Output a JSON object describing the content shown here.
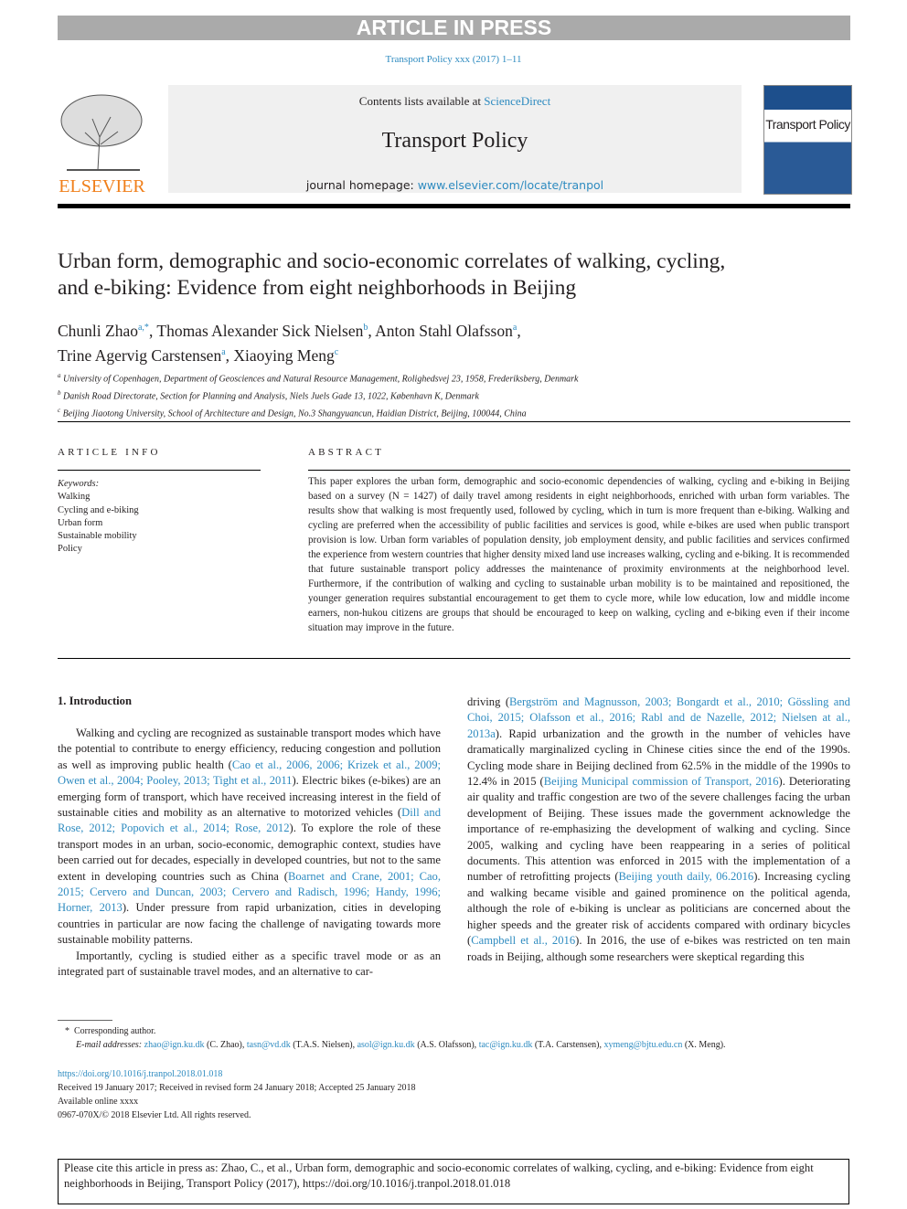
{
  "banner": "ARTICLE IN PRESS",
  "journal_ref": "Transport Policy xxx (2017) 1–11",
  "masthead": {
    "contents_prefix": "Contents lists available at ",
    "contents_link": "ScienceDirect",
    "journal_title": "Transport Policy",
    "homepage_prefix": "journal homepage: ",
    "homepage_link": "www.elsevier.com/locate/tranpol",
    "publisher": "ELSEVIER",
    "cover_title": "Transport Policy"
  },
  "title": "Urban form, demographic and socio-economic correlates of walking, cycling, and e-biking: Evidence from eight neighborhoods in Beijing",
  "authors": [
    {
      "name": "Chunli Zhao",
      "sup": "a,*"
    },
    {
      "name": "Thomas Alexander Sick Nielsen",
      "sup": "b"
    },
    {
      "name": "Anton Stahl Olafsson",
      "sup": "a"
    },
    {
      "name": "Trine Agervig Carstensen",
      "sup": "a"
    },
    {
      "name": "Xiaoying Meng",
      "sup": "c"
    }
  ],
  "affiliations": [
    {
      "sup": "a",
      "text": "University of Copenhagen, Department of Geosciences and Natural Resource Management, Rolighedsvej 23, 1958, Frederiksberg, Denmark"
    },
    {
      "sup": "b",
      "text": "Danish Road Directorate, Section for Planning and Analysis, Niels Juels Gade 13, 1022, København K, Denmark"
    },
    {
      "sup": "c",
      "text": "Beijing Jiaotong University, School of Architecture and Design, No.3 Shangyuancun, Haidian District, Beijing, 100044, China"
    }
  ],
  "article_info": {
    "heading": "ARTICLE INFO",
    "keywords_label": "Keywords:",
    "keywords": [
      "Walking",
      "Cycling and e-biking",
      "Urban form",
      "Sustainable mobility",
      "Policy"
    ]
  },
  "abstract": {
    "heading": "ABSTRACT",
    "text": "This paper explores the urban form, demographic and socio-economic dependencies of walking, cycling and e-biking in Beijing based on a survey (N = 1427) of daily travel among residents in eight neighborhoods, enriched with urban form variables. The results show that walking is most frequently used, followed by cycling, which in turn is more frequent than e-biking. Walking and cycling are preferred when the accessibility of public facilities and services is good, while e-bikes are used when public transport provision is low. Urban form variables of population density, job employment density, and public facilities and services confirmed the experience from western countries that higher density mixed land use increases walking, cycling and e-biking. It is recommended that future sustainable transport policy addresses the maintenance of proximity environments at the neighbor­hood level. Furthermore, if the contribution of walking and cycling to sustainable urban mobility is to be maintained and repositioned, the younger generation requires substantial encouragement to get them to cycle more, while low education, low and middle income earners, non-hukou citizens are groups that should be encouraged to keep on walking, cycling and e-biking even if their income situation may improve in the future."
  },
  "section_heading": "1.  Introduction",
  "col1": [
    [
      {
        "t": "Walking and cycling are recognized as sustainable transport modes which have the potential to contribute to energy efficiency, reducing congestion and pollution as well as improving public health ("
      },
      {
        "t": "Cao et al., 2006, 2006; Krizek et al., 2009; Owen et al., 2004; Pooley, 2013; Tight et al., 2011",
        "l": 1
      },
      {
        "t": "). Electric bikes (e-bikes) are an emerging form of transport, which have received increasing interest in the field of sustainable cities and mobility as an alternative to motorized vehicles ("
      },
      {
        "t": "Dill and Rose, 2012; Popovich et al., 2014; Rose, 2012",
        "l": 1
      },
      {
        "t": "). To explore the role of these transport modes in an urban, socio-economic, demographic context, studies have been carried out for decades, especially in developed countries, but not to the same extent in developing countries such as China ("
      },
      {
        "t": "Boarnet and Crane, 2001; Cao, 2015; Cervero and Duncan, 2003; Cervero and Rad­isch, 1996; Handy, 1996; Horner, 2013",
        "l": 1
      },
      {
        "t": "). Under pressure from rapid ur­banization, cities in developing countries in particular are now facing the challenge of navigating towards more sustainable mobility patterns."
      }
    ],
    [
      {
        "t": "Importantly, cycling is studied either as a specific travel mode or as an integrated part of sustainable travel modes, and an alternative to car-"
      }
    ]
  ],
  "col2": [
    [
      {
        "t": "driving ("
      },
      {
        "t": "Bergström and Magnusson, 2003; Bongardt et al., 2010; Gössling and Choi, 2015; Olafsson et al., 2016; Rabl and de Nazelle, 2012; Nielsen at al., 2013a",
        "l": 1
      },
      {
        "t": "). Rapid urbanization and the growth in the number of vehicles have dramatically marginalized cycling in Chinese cities since the end of the 1990s. Cycling mode share in Beijing declined from 62.5% in the middle of the 1990s to 12.4% in 2015 ("
      },
      {
        "t": "Beijing Municipal commission of Transport, 2016",
        "l": 1
      },
      {
        "t": "). Deteriorating air quality and traffic congestion are two of the severe challenges facing the urban development of Beijing. These issues made the government acknowledge the importance of re-emphasizing the development of walking and cycling. Since 2005, walking and cycling have been reappearing in a series of political documents. This attention was enforced in 2015 with the implementation of a number of retrofitting projects ("
      },
      {
        "t": "Beijing youth daily, 06.2016",
        "l": 1
      },
      {
        "t": "). Increasing cycling and walking became visible and gained prominence on the political agenda, although the role of e-biking is unclear as politicians are concerned about the higher speeds and the greater risk of accidents compared with ordinary bicycles ("
      },
      {
        "t": "Campbell et al., 2016",
        "l": 1
      },
      {
        "t": "). In 2016, the use of e-bikes was restricted on ten main roads in Beijing, although some researchers were skeptical regarding this"
      }
    ]
  ],
  "footnotes": {
    "corresponding": "Corresponding author.",
    "email_label": "E-mail addresses:",
    "emails": [
      {
        "email": "zhao@ign.ku.dk",
        "who": " (C. Zhao), "
      },
      {
        "email": "tasn@vd.dk",
        "who": " (T.A.S. Nielsen), "
      },
      {
        "email": "asol@ign.ku.dk",
        "who": " (A.S. Olafsson), "
      },
      {
        "email": "tac@ign.ku.dk",
        "who": " (T.A. Carstensen), "
      },
      {
        "email": "xymeng@bjtu.edu.cn",
        "who": " (X. Meng)."
      }
    ],
    "doi": "https://doi.org/10.1016/j.tranpol.2018.01.018",
    "received": "Received 19 January 2017; Received in revised form 24 January 2018; Accepted 25 January 2018",
    "available": "Available online xxxx",
    "copyright": "0967-070X/© 2018 Elsevier Ltd. All rights reserved."
  },
  "citation": "Please cite this article in press as: Zhao, C., et al., Urban form, demographic and socio-economic correlates of walking, cycling, and e-biking: Evidence from eight neighborhoods in Beijing, Transport Policy (2017), https://doi.org/10.1016/j.tranpol.2018.01.018",
  "colors": {
    "link": "#2e8bc0",
    "elsevier_orange": "#f07f1a",
    "banner_gray": "#aaaaaa"
  }
}
